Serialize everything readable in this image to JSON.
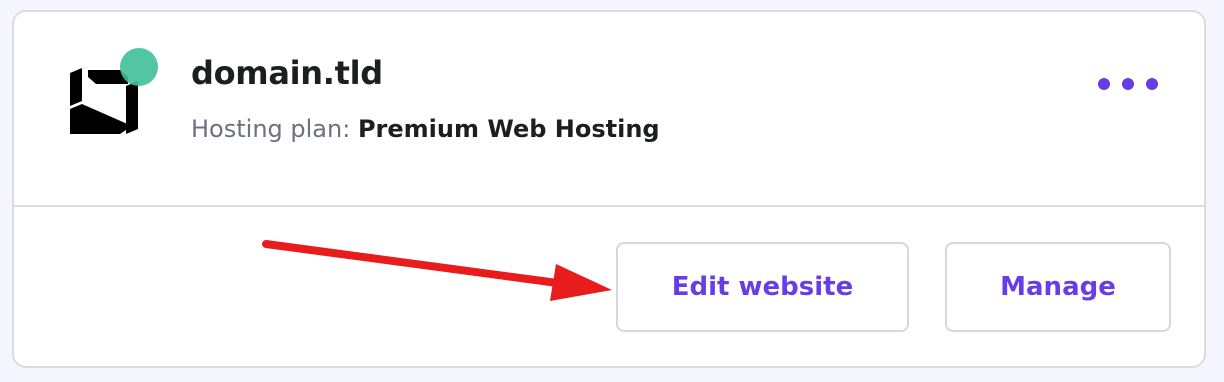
{
  "site": {
    "title": "domain.tld",
    "plan_label": "Hosting plan:",
    "plan_value": "Premium Web Hosting",
    "status": "active"
  },
  "actions": {
    "edit_label": "Edit website",
    "manage_label": "Manage",
    "more_icon": "more-horizontal-icon"
  },
  "colors": {
    "accent": "#673de6",
    "status_dot": "#3fbf99",
    "annotation_arrow": "#e81c1c",
    "text_primary": "#1d1e20",
    "text_secondary": "#6d7081"
  }
}
